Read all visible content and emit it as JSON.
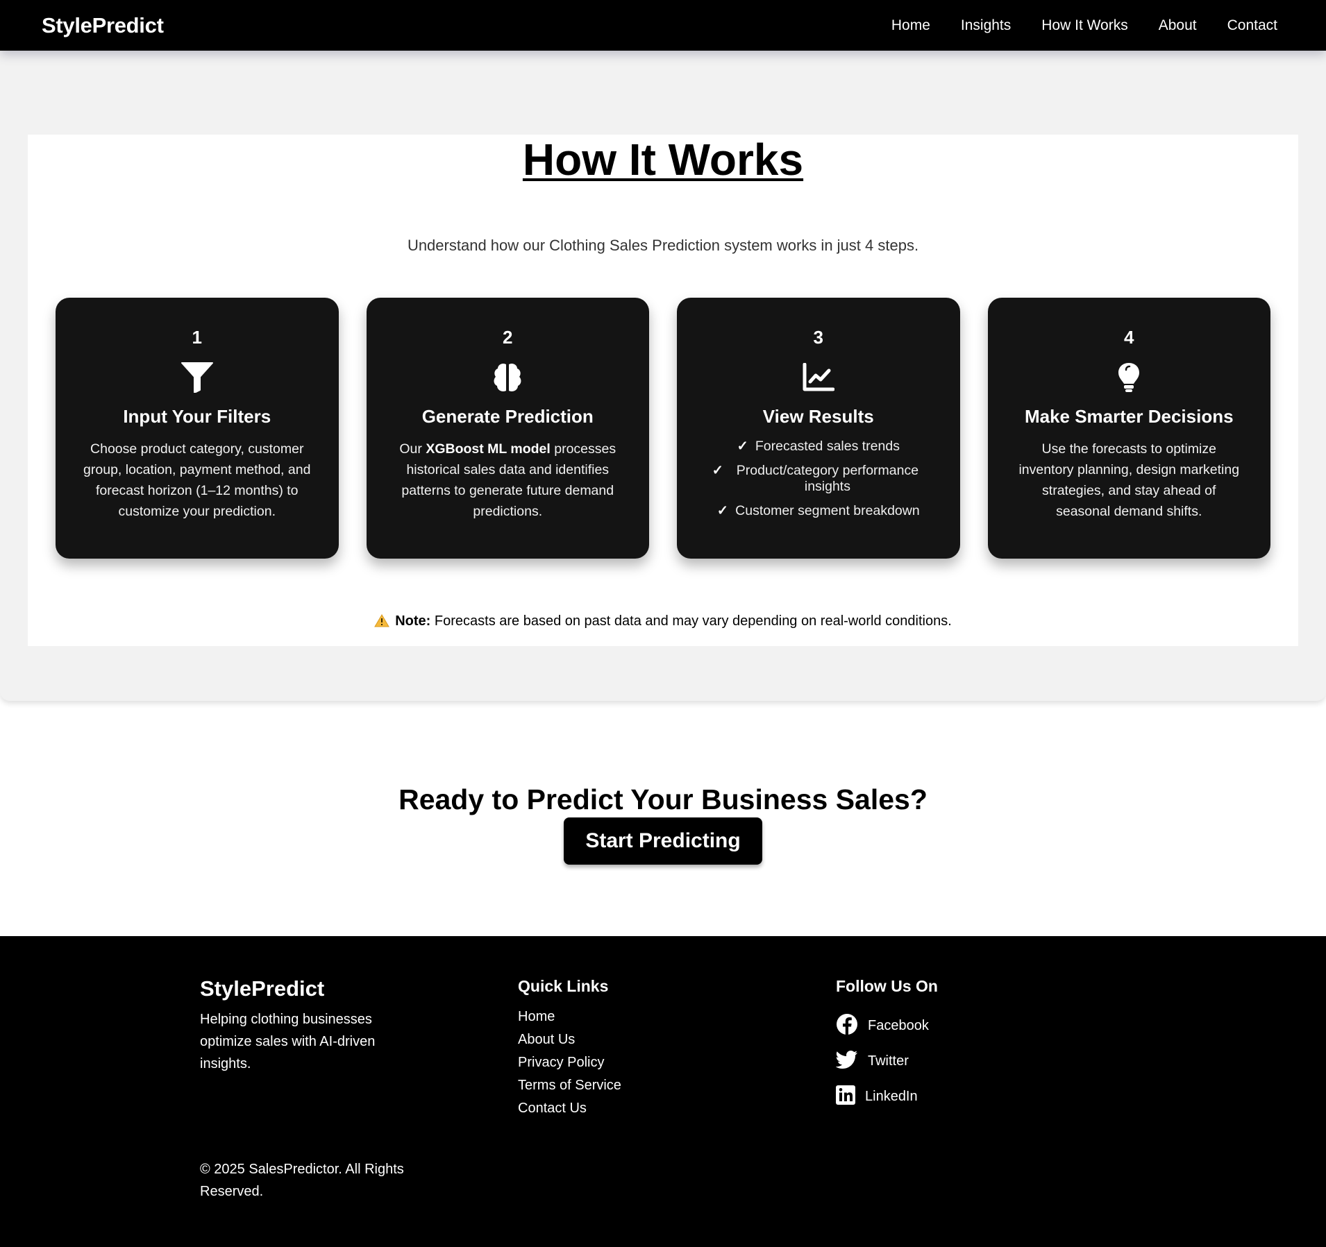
{
  "nav": {
    "brand": "StylePredict",
    "links": [
      "Home",
      "Insights",
      "How It Works",
      "About",
      "Contact"
    ]
  },
  "how_it_works": {
    "title": "How It Works",
    "subtitle": "Understand how our Clothing Sales Prediction system works in just 4 steps.",
    "steps": [
      {
        "number": "1",
        "icon": "funnel-icon",
        "title": "Input Your Filters",
        "description": "Choose product category, customer group, location, payment method, and forecast horizon (1–12 months) to customize your prediction."
      },
      {
        "number": "2",
        "icon": "brain-icon",
        "title": "Generate Prediction",
        "desc_prefix": "Our ",
        "desc_bold": "XGBoost ML model",
        "desc_suffix": " processes historical sales data and identifies patterns to generate future demand predictions."
      },
      {
        "number": "3",
        "icon": "line-chart-icon",
        "title": "View Results",
        "check_mark": "✓",
        "bullets": [
          "Forecasted sales trends",
          "Product/category performance insights",
          "Customer segment breakdown"
        ]
      },
      {
        "number": "4",
        "icon": "lightbulb-icon",
        "title": "Make Smarter Decisions",
        "description": "Use the forecasts to optimize inventory planning, design marketing strategies, and stay ahead of seasonal demand shifts."
      }
    ],
    "note_label": "Note:",
    "note_text": " Forecasts are based on past data and may vary depending on real-world conditions.",
    "note_icon": "warning-icon"
  },
  "cta": {
    "title": "Ready to Predict Your Business Sales?",
    "button": "Start Predicting"
  },
  "footer": {
    "brand": "StylePredict",
    "tagline": "Helping clothing businesses optimize sales with AI-driven insights.",
    "copyright": "© 2025 SalesPredictor. All Rights Reserved.",
    "quick_links_title": "Quick Links",
    "quick_links": [
      "Home",
      "About Us",
      "Privacy Policy",
      "Terms of Service",
      "Contact Us"
    ],
    "follow_title": "Follow Us On",
    "social": [
      {
        "icon": "facebook-icon",
        "label": "Facebook"
      },
      {
        "icon": "twitter-icon",
        "label": "Twitter"
      },
      {
        "icon": "linkedin-icon",
        "label": "LinkedIn"
      }
    ]
  }
}
